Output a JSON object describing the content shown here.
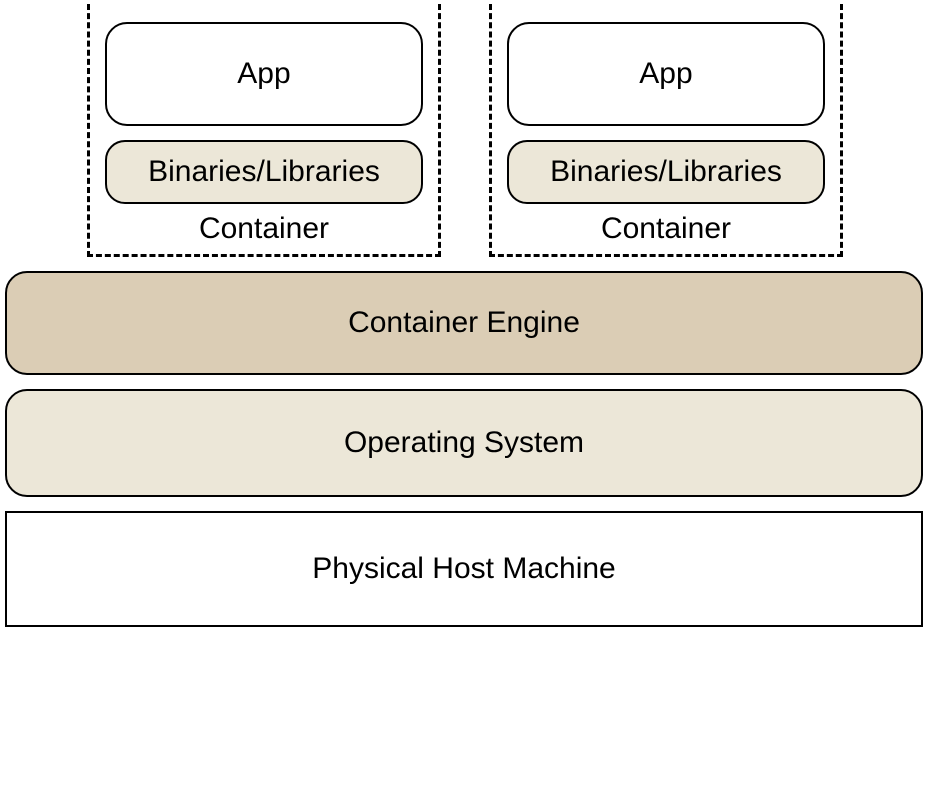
{
  "containers": [
    {
      "app": "App",
      "binaries": "Binaries/Libraries",
      "label": "Container"
    },
    {
      "app": "App",
      "binaries": "Binaries/Libraries",
      "label": "Container"
    }
  ],
  "layers": {
    "engine": "Container Engine",
    "os": "Operating System",
    "host": "Physical Host Machine"
  }
}
